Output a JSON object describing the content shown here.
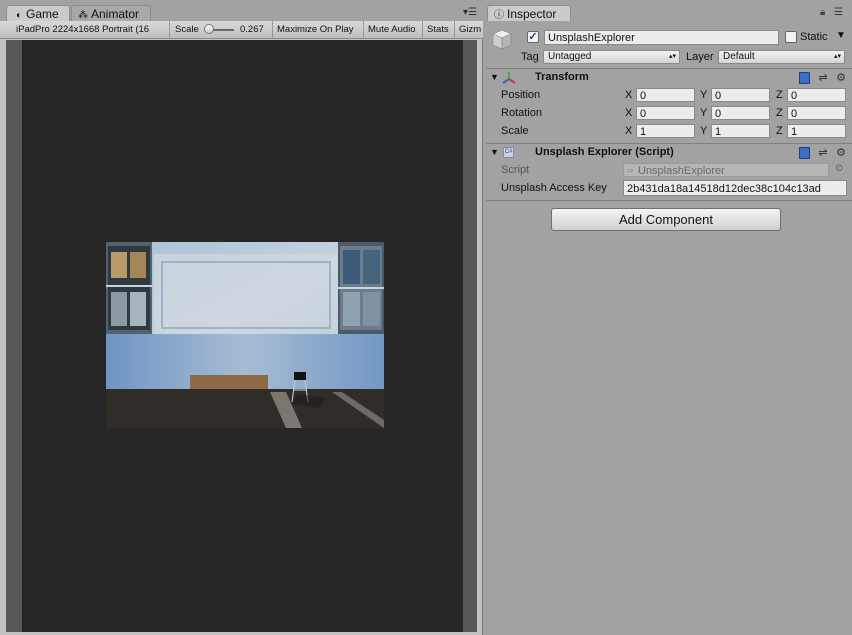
{
  "tabs": {
    "game": "Game",
    "animator": "Animator",
    "inspector": "Inspector"
  },
  "game_toolbar": {
    "resolution": "iPadPro 2224x1668 Portrait (16",
    "scale_label": "Scale",
    "scale_value": "0.267",
    "scale_slider_fraction": 0.0,
    "maximize": "Maximize On Play",
    "mute": "Mute Audio",
    "stats": "Stats",
    "gizmos": "Gizm"
  },
  "inspector": {
    "object_name": "UnsplashExplorer",
    "active_checked": true,
    "static_label": "Static",
    "static_checked": false,
    "tag_label": "Tag",
    "tag_value": "Untagged",
    "layer_label": "Layer",
    "layer_value": "Default",
    "transform": {
      "title": "Transform",
      "position_label": "Position",
      "rotation_label": "Rotation",
      "scale_label": "Scale",
      "axis_x": "X",
      "axis_y": "Y",
      "axis_z": "Z",
      "position": {
        "x": "0",
        "y": "0",
        "z": "0"
      },
      "rotation": {
        "x": "0",
        "y": "0",
        "z": "0"
      },
      "scale": {
        "x": "1",
        "y": "1",
        "z": "1"
      }
    },
    "script_component": {
      "title": "Unsplash Explorer (Script)",
      "script_label": "Script",
      "script_value": "UnsplashExplorer",
      "access_key_label": "Unsplash Access Key",
      "access_key_value": "2b431da18a14518d12dec38c104c13ad"
    },
    "add_component": "Add Component"
  },
  "icons": {
    "game_tab": "pacman-icon",
    "animator_tab": "animator-icon",
    "inspector_tab": "info-icon",
    "transform": "transform-axes-icon",
    "script": "script-icon",
    "help": "help-book-icon",
    "preset": "preset-icon",
    "settings": "gear-icon",
    "lock": "lock-icon",
    "menu": "menu-icon"
  }
}
